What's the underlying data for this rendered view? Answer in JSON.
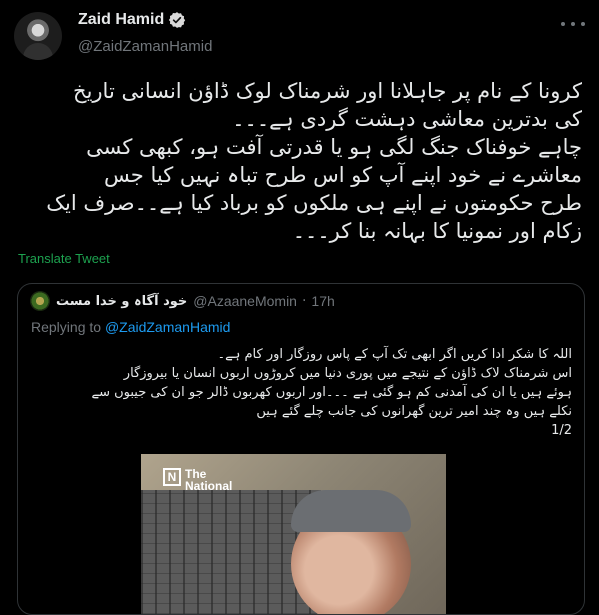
{
  "author": {
    "name": "Zaid Hamid",
    "handle": "@ZaidZamanHamid"
  },
  "tweet": {
    "text": "کرونا کے نام پر جاہلانا اور شرمناک لوک ڈاؤن انسانی تاریخ\nکی بدترین معاشی دہشت گردی ہے۔۔۔\nچاہے خوفناک جنگ لگی ہو یا قدرتی آفت ہو، کبھی کسی\nمعاشرے نے خود اپنے آپ کو اس طرح تباہ نہیں کیا جس\nطرح حکومتوں نے اپنے ہی ملکوں کو برباد کیا ہے۔۔صرف ایک\nزکام اور نمونیا کا بہانہ بنا کر۔۔۔",
    "translate_label": "Translate Tweet"
  },
  "quote": {
    "author_name": "خود آگاہ و خدا مست",
    "handle": "@AzaaneMomin",
    "time": "17h",
    "replying_prefix": "Replying to ",
    "replying_handle": "@ZaidZamanHamid",
    "text": "اللہ کا شکر ادا کریں اگر ابھی تک آپ کے پاس روزگار اور کام ہے۔\nاس شرمناک لاک ڈاؤن کے نتیجے میں پوری دنیا میں کروڑوں اربوں انسان یا بیروزگار\nہوئے ہیں یا ان کی آمدنی کم ہو گئی ہے ۔۔۔اور اربوں کھربوں ڈالر جو ان کی جیبوں سے\nنکلے ہیں وہ چند امیر ترین گھرانوں کی جانب چلے گئے ہیں\n1/2",
    "media_logo_mark": "N",
    "media_logo_text": "The\nNational"
  },
  "colors": {
    "background": "#000000",
    "text": "#e7e9ea",
    "secondary": "#71767b",
    "link": "#1d9bf0",
    "translate": "#1da14f"
  },
  "icons": {
    "verified": "verified-badge-icon",
    "more": "more-options-icon"
  }
}
